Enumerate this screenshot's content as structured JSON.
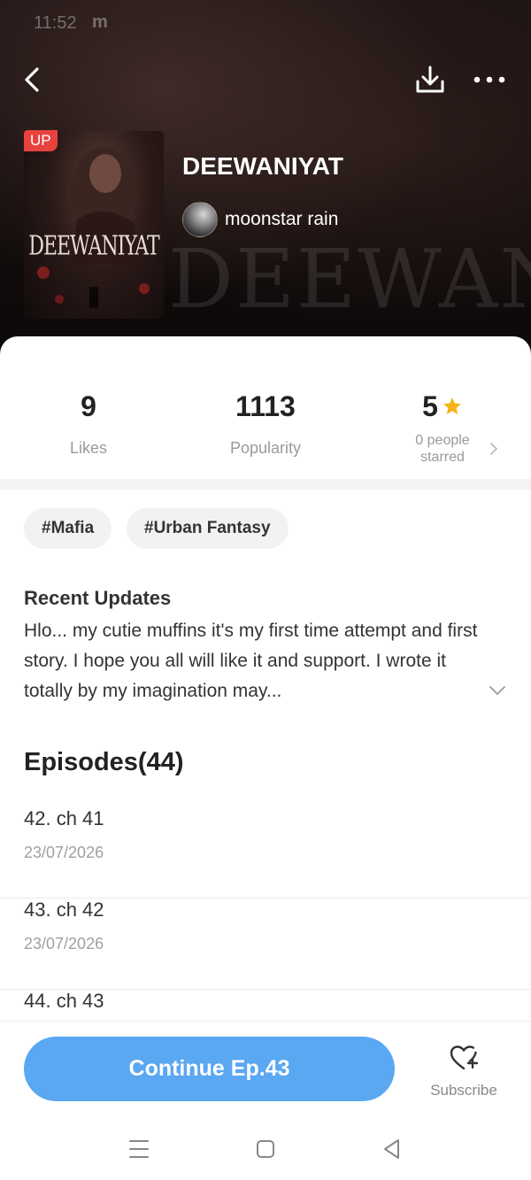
{
  "status_bar": {
    "time": "11:52",
    "extra": "m"
  },
  "header": {
    "back_icon": "chevron-left-icon",
    "download_icon": "download-icon",
    "more_icon": "more-horizontal-icon"
  },
  "book": {
    "badge": "UP",
    "title": "DEEWANIYAT",
    "cover_title": "DEEWANIYAT",
    "author": "moonstar rain",
    "watermark": "DEEWANIYAT"
  },
  "stats": {
    "likes": {
      "value": "9",
      "label": "Likes"
    },
    "popularity": {
      "value": "1113",
      "label": "Popularity"
    },
    "rating": {
      "value": "5",
      "label_line1": "0 people",
      "label_line2": "starred",
      "star_color": "#f5b315"
    }
  },
  "tags": [
    "#Mafia",
    "#Urban Fantasy"
  ],
  "recent_updates": {
    "title": "Recent Updates",
    "text": "Hlo... my cutie muffins it's my first time attempt and first story. I hope you all will like it and support. I wrote it totally by my imagination may..."
  },
  "episodes": {
    "title": "Episodes(44)",
    "items": [
      {
        "name": "42. ch 41",
        "date": "23/07/2026"
      },
      {
        "name": "43. ch 42",
        "date": "23/07/2026"
      },
      {
        "name": "44. ch 43",
        "date": ""
      }
    ]
  },
  "bottom_bar": {
    "continue_label": "Continue Ep.43",
    "subscribe_label": "Subscribe",
    "accent": "#5aa7f2"
  },
  "nav_bar": {
    "menu_icon": "menu-icon",
    "home_icon": "home-square-icon",
    "back_icon": "back-triangle-icon"
  }
}
